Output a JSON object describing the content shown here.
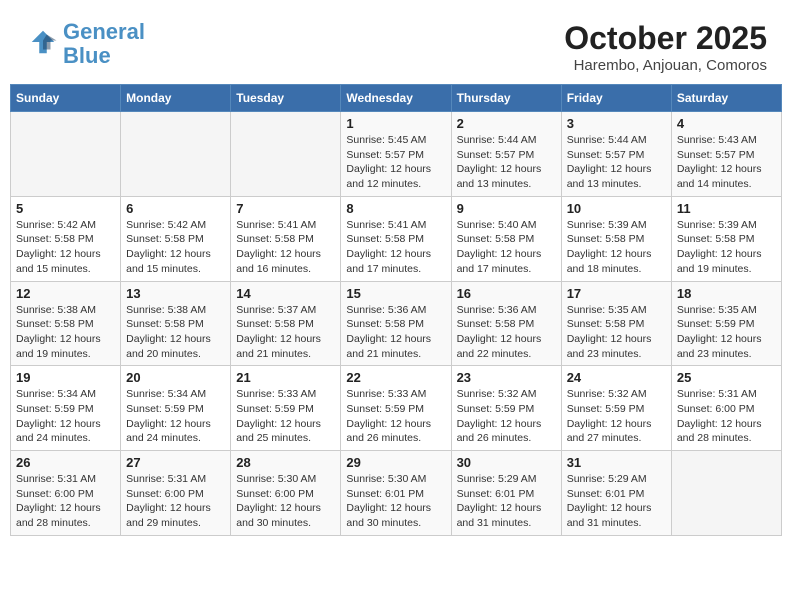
{
  "header": {
    "logo_line1": "General",
    "logo_line2": "Blue",
    "month": "October 2025",
    "location": "Harembo, Anjouan, Comoros"
  },
  "weekdays": [
    "Sunday",
    "Monday",
    "Tuesday",
    "Wednesday",
    "Thursday",
    "Friday",
    "Saturday"
  ],
  "weeks": [
    [
      {
        "day": "",
        "info": ""
      },
      {
        "day": "",
        "info": ""
      },
      {
        "day": "",
        "info": ""
      },
      {
        "day": "1",
        "info": "Sunrise: 5:45 AM\nSunset: 5:57 PM\nDaylight: 12 hours\nand 12 minutes."
      },
      {
        "day": "2",
        "info": "Sunrise: 5:44 AM\nSunset: 5:57 PM\nDaylight: 12 hours\nand 13 minutes."
      },
      {
        "day": "3",
        "info": "Sunrise: 5:44 AM\nSunset: 5:57 PM\nDaylight: 12 hours\nand 13 minutes."
      },
      {
        "day": "4",
        "info": "Sunrise: 5:43 AM\nSunset: 5:57 PM\nDaylight: 12 hours\nand 14 minutes."
      }
    ],
    [
      {
        "day": "5",
        "info": "Sunrise: 5:42 AM\nSunset: 5:58 PM\nDaylight: 12 hours\nand 15 minutes."
      },
      {
        "day": "6",
        "info": "Sunrise: 5:42 AM\nSunset: 5:58 PM\nDaylight: 12 hours\nand 15 minutes."
      },
      {
        "day": "7",
        "info": "Sunrise: 5:41 AM\nSunset: 5:58 PM\nDaylight: 12 hours\nand 16 minutes."
      },
      {
        "day": "8",
        "info": "Sunrise: 5:41 AM\nSunset: 5:58 PM\nDaylight: 12 hours\nand 17 minutes."
      },
      {
        "day": "9",
        "info": "Sunrise: 5:40 AM\nSunset: 5:58 PM\nDaylight: 12 hours\nand 17 minutes."
      },
      {
        "day": "10",
        "info": "Sunrise: 5:39 AM\nSunset: 5:58 PM\nDaylight: 12 hours\nand 18 minutes."
      },
      {
        "day": "11",
        "info": "Sunrise: 5:39 AM\nSunset: 5:58 PM\nDaylight: 12 hours\nand 19 minutes."
      }
    ],
    [
      {
        "day": "12",
        "info": "Sunrise: 5:38 AM\nSunset: 5:58 PM\nDaylight: 12 hours\nand 19 minutes."
      },
      {
        "day": "13",
        "info": "Sunrise: 5:38 AM\nSunset: 5:58 PM\nDaylight: 12 hours\nand 20 minutes."
      },
      {
        "day": "14",
        "info": "Sunrise: 5:37 AM\nSunset: 5:58 PM\nDaylight: 12 hours\nand 21 minutes."
      },
      {
        "day": "15",
        "info": "Sunrise: 5:36 AM\nSunset: 5:58 PM\nDaylight: 12 hours\nand 21 minutes."
      },
      {
        "day": "16",
        "info": "Sunrise: 5:36 AM\nSunset: 5:58 PM\nDaylight: 12 hours\nand 22 minutes."
      },
      {
        "day": "17",
        "info": "Sunrise: 5:35 AM\nSunset: 5:58 PM\nDaylight: 12 hours\nand 23 minutes."
      },
      {
        "day": "18",
        "info": "Sunrise: 5:35 AM\nSunset: 5:59 PM\nDaylight: 12 hours\nand 23 minutes."
      }
    ],
    [
      {
        "day": "19",
        "info": "Sunrise: 5:34 AM\nSunset: 5:59 PM\nDaylight: 12 hours\nand 24 minutes."
      },
      {
        "day": "20",
        "info": "Sunrise: 5:34 AM\nSunset: 5:59 PM\nDaylight: 12 hours\nand 24 minutes."
      },
      {
        "day": "21",
        "info": "Sunrise: 5:33 AM\nSunset: 5:59 PM\nDaylight: 12 hours\nand 25 minutes."
      },
      {
        "day": "22",
        "info": "Sunrise: 5:33 AM\nSunset: 5:59 PM\nDaylight: 12 hours\nand 26 minutes."
      },
      {
        "day": "23",
        "info": "Sunrise: 5:32 AM\nSunset: 5:59 PM\nDaylight: 12 hours\nand 26 minutes."
      },
      {
        "day": "24",
        "info": "Sunrise: 5:32 AM\nSunset: 5:59 PM\nDaylight: 12 hours\nand 27 minutes."
      },
      {
        "day": "25",
        "info": "Sunrise: 5:31 AM\nSunset: 6:00 PM\nDaylight: 12 hours\nand 28 minutes."
      }
    ],
    [
      {
        "day": "26",
        "info": "Sunrise: 5:31 AM\nSunset: 6:00 PM\nDaylight: 12 hours\nand 28 minutes."
      },
      {
        "day": "27",
        "info": "Sunrise: 5:31 AM\nSunset: 6:00 PM\nDaylight: 12 hours\nand 29 minutes."
      },
      {
        "day": "28",
        "info": "Sunrise: 5:30 AM\nSunset: 6:00 PM\nDaylight: 12 hours\nand 30 minutes."
      },
      {
        "day": "29",
        "info": "Sunrise: 5:30 AM\nSunset: 6:01 PM\nDaylight: 12 hours\nand 30 minutes."
      },
      {
        "day": "30",
        "info": "Sunrise: 5:29 AM\nSunset: 6:01 PM\nDaylight: 12 hours\nand 31 minutes."
      },
      {
        "day": "31",
        "info": "Sunrise: 5:29 AM\nSunset: 6:01 PM\nDaylight: 12 hours\nand 31 minutes."
      },
      {
        "day": "",
        "info": ""
      }
    ]
  ]
}
